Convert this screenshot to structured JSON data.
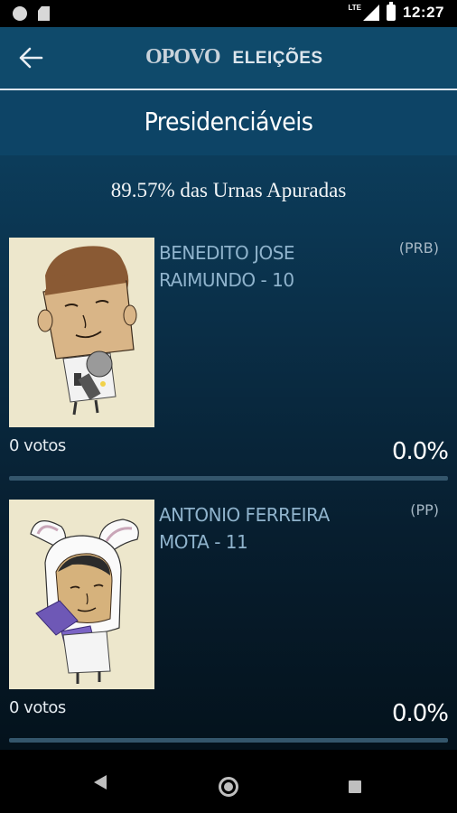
{
  "status_bar": {
    "time": "12:27",
    "network": "LTE",
    "icons": [
      "notification-circle-icon",
      "sd-card-icon",
      "signal-icon",
      "battery-charging-icon"
    ]
  },
  "toolbar": {
    "back_icon": "arrow-left-icon",
    "brand_logo": "OPOVO",
    "brand_label": "ELEIÇÕES"
  },
  "section": {
    "title": "Presidenciáveis"
  },
  "summary": {
    "text": "89.57% das Urnas Apuradas"
  },
  "candidates": [
    {
      "name": "BENEDITO JOSE RAIMUNDO - 10",
      "party": "(PRB)",
      "votes": "0 votos",
      "percent": "0.0%",
      "avatar": "candidate-caricature-microphone"
    },
    {
      "name": "ANTONIO FERREIRA MOTA - 11",
      "party": "(PP)",
      "votes": "0 votos",
      "percent": "0.0%",
      "avatar": "candidate-caricature-bunny-costume"
    }
  ],
  "colors": {
    "toolbar_bg": "#0f4a6b",
    "name_color": "#8fb3cc",
    "photo_bg": "#ede7cc"
  },
  "nav_bar": {
    "icons": [
      "nav-back-icon",
      "nav-home-icon",
      "nav-recents-icon"
    ]
  }
}
